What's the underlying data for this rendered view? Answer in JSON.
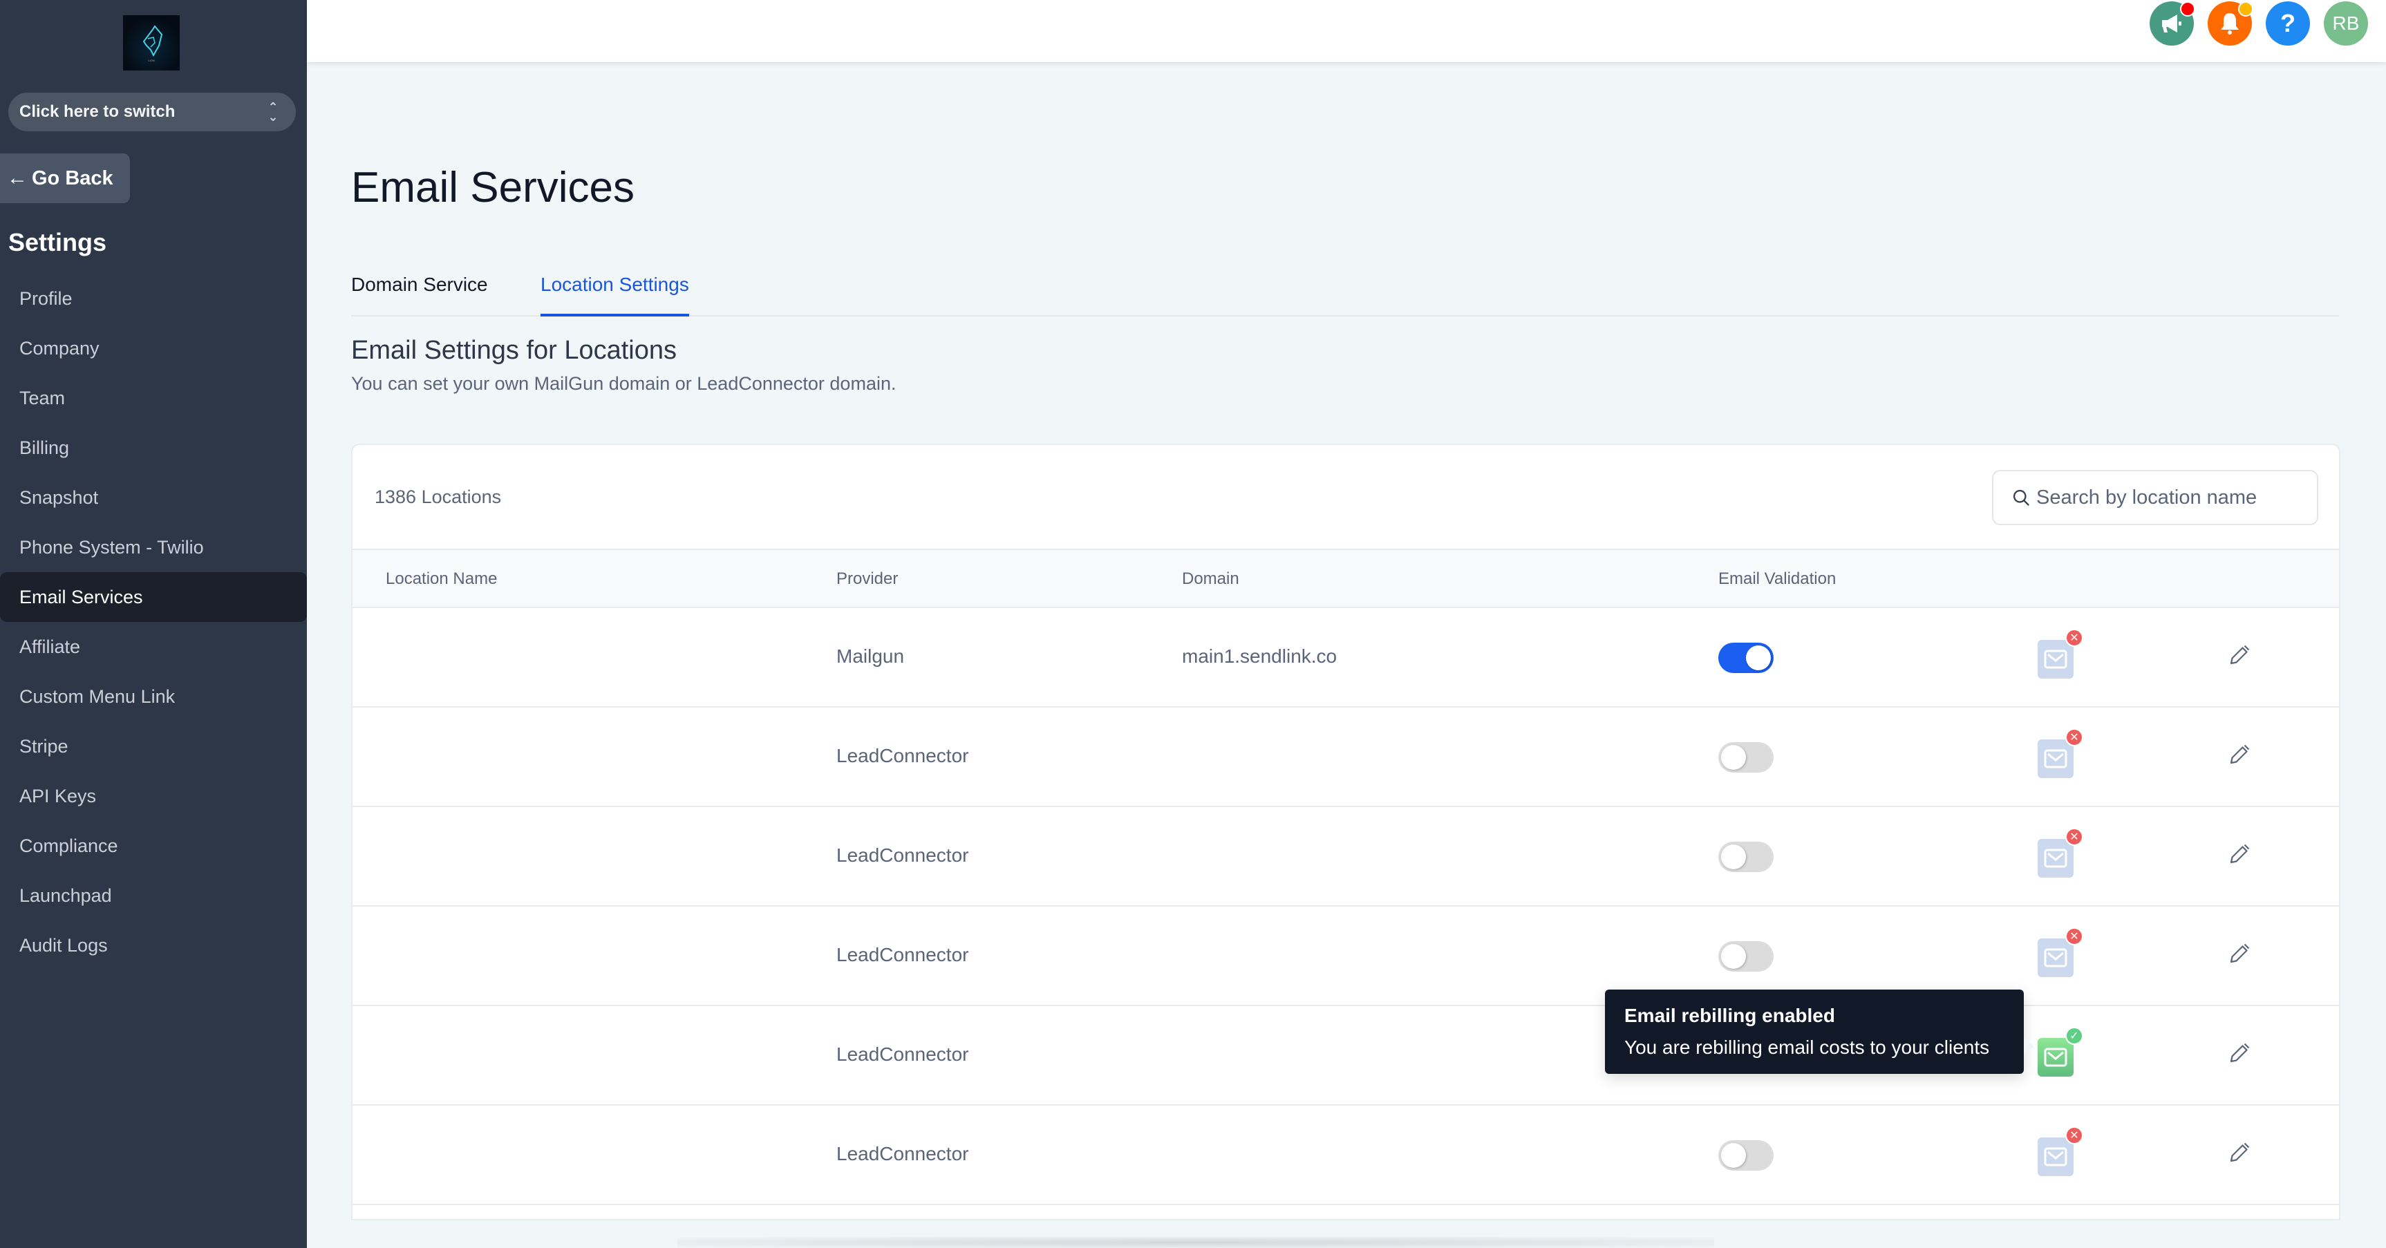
{
  "sidebar": {
    "logo_alt": "Lion logo",
    "switcher_label": "Click here to switch",
    "go_back_label": "Go Back",
    "settings_heading": "Settings",
    "items": [
      {
        "label": "Profile",
        "active": false
      },
      {
        "label": "Company",
        "active": false
      },
      {
        "label": "Team",
        "active": false
      },
      {
        "label": "Billing",
        "active": false
      },
      {
        "label": "Snapshot",
        "active": false
      },
      {
        "label": "Phone System - Twilio",
        "active": false
      },
      {
        "label": "Email Services",
        "active": true
      },
      {
        "label": "Affiliate",
        "active": false
      },
      {
        "label": "Custom Menu Link",
        "active": false
      },
      {
        "label": "Stripe",
        "active": false
      },
      {
        "label": "API Keys",
        "active": false
      },
      {
        "label": "Compliance",
        "active": false
      },
      {
        "label": "Launchpad",
        "active": false
      },
      {
        "label": "Audit Logs",
        "active": false
      }
    ]
  },
  "header": {
    "icons": [
      {
        "name": "megaphone-icon",
        "color": "#479b80",
        "badge_color": "#ff0000"
      },
      {
        "name": "bell-icon",
        "color": "#ff6a00",
        "badge_color": "#ffb800"
      },
      {
        "name": "help-icon",
        "color": "#1e8af2",
        "glyph": "?"
      },
      {
        "name": "user-avatar",
        "color": "#79bf8e",
        "initials": "RB"
      }
    ]
  },
  "main": {
    "title": "Email Services",
    "tabs": [
      {
        "label": "Domain Service",
        "active": false
      },
      {
        "label": "Location Settings",
        "active": true
      }
    ],
    "section_title": "Email Settings for Locations",
    "section_subtitle": "You can set your own MailGun domain or LeadConnector domain.",
    "table": {
      "count_label": "1386 Locations",
      "search_placeholder": "Search by location name",
      "columns": [
        "Location Name",
        "Provider",
        "Domain",
        "Email Validation"
      ],
      "rows": [
        {
          "location_name": "",
          "provider": "Mailgun",
          "domain": "main1.sendlink.co",
          "email_validation": true,
          "rebilling": false
        },
        {
          "location_name": "",
          "provider": "LeadConnector",
          "domain": "",
          "email_validation": false,
          "rebilling": false
        },
        {
          "location_name": "",
          "provider": "LeadConnector",
          "domain": "",
          "email_validation": false,
          "rebilling": false
        },
        {
          "location_name": "",
          "provider": "LeadConnector",
          "domain": "",
          "email_validation": false,
          "rebilling": false
        },
        {
          "location_name": "",
          "provider": "LeadConnector",
          "domain": "",
          "email_validation": false,
          "rebilling": true
        },
        {
          "location_name": "",
          "provider": "LeadConnector",
          "domain": "",
          "email_validation": false,
          "rebilling": false
        }
      ]
    },
    "tooltip": {
      "title": "Email rebilling enabled",
      "body": "You are rebilling email costs to your clients"
    }
  },
  "colors": {
    "accent": "#1a56db",
    "toggle_on": "#1a5ff0",
    "sidebar_bg": "#2e3748",
    "rebilling_off_badge": "#ee5b5b",
    "rebilling_on_badge": "#5fcf86"
  }
}
